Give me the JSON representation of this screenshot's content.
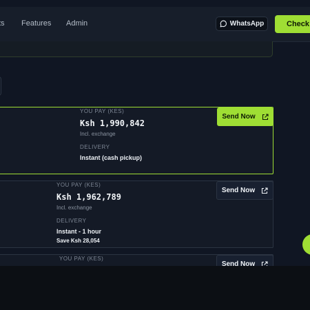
{
  "nav": {
    "links": [
      "ts",
      "Features",
      "Admin"
    ],
    "whatsapp_label": "WhatsApp",
    "check_label": "Check R"
  },
  "offers": [
    {
      "you_pay_label": "YOU PAY (KES)",
      "amount": "Ksh 1,990,842",
      "exchange_note": "Incl. exchange",
      "delivery_label": "DELIVERY",
      "delivery_value": "Instant (cash pickup)",
      "savings": "",
      "send_label": "Send Now"
    },
    {
      "you_pay_label": "YOU PAY (KES)",
      "amount": "Ksh 1,962,789",
      "exchange_note": "Incl. exchange",
      "delivery_label": "DELIVERY",
      "delivery_value": "Instant - 1 hour",
      "savings": "Save Ksh 28,054",
      "send_label": "Send Now"
    },
    {
      "you_pay_label": "YOU PAY (KES)",
      "send_label": "Send Now"
    }
  ],
  "colors": {
    "accent": "#9fde34",
    "background": "#101623",
    "card": "#141a26"
  }
}
